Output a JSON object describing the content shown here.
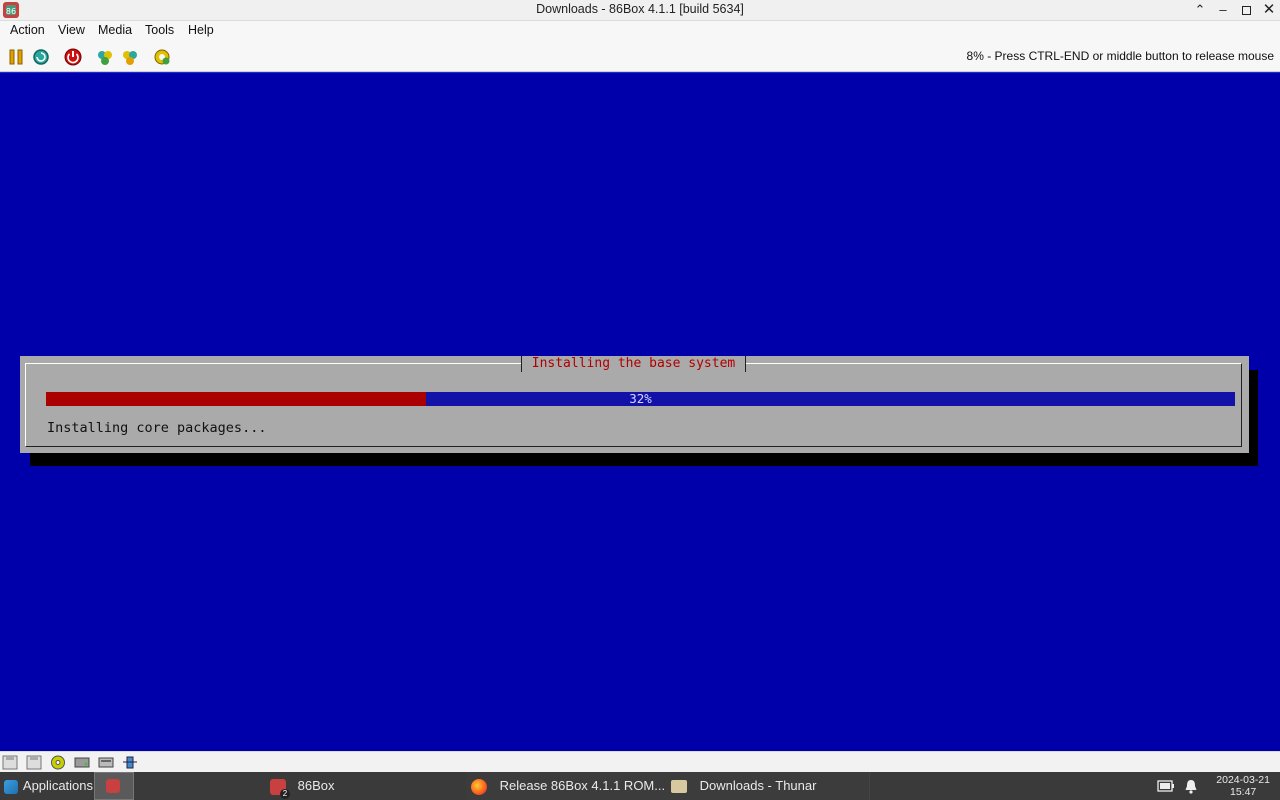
{
  "window": {
    "title": "Downloads - 86Box 4.1.1 [build 5634]",
    "controls": [
      "maximize-up",
      "minimize",
      "restore",
      "close"
    ]
  },
  "menu": {
    "action": "Action",
    "view": "View",
    "media": "Media",
    "tools": "Tools",
    "help": "Help"
  },
  "toolbar": {
    "icons": [
      "pause-icon",
      "reset-icon",
      "power-icon",
      "ctrl-alt-del-icon",
      "ctrl-alt-esc-icon",
      "settings-icon"
    ],
    "status_message": "8% - Press CTRL-END or middle button to release mouse"
  },
  "installer": {
    "dialog_title": "Installing the base system",
    "progress_percent": 32,
    "progress_label": "32%",
    "message": "Installing core packages...",
    "colors": {
      "screen": "#0000aa",
      "dialog": "#aaaaaa",
      "progress_fill": "#aa0000",
      "title_text": "#b00000"
    }
  },
  "statusbar": {
    "icons": [
      "floppy-icon",
      "floppy-2-icon",
      "cdrom-icon",
      "hdd-icon",
      "keyboard-icon",
      "network-icon"
    ]
  },
  "taskbar": {
    "applications": "Applications",
    "tasks": [
      {
        "label": "86Box",
        "badge": "2"
      },
      {
        "label": "Release 86Box 4.1.1 ROM..."
      },
      {
        "label": "Downloads - Thunar"
      }
    ],
    "clock_date": "2024-03-21",
    "clock_time": "15:47"
  }
}
